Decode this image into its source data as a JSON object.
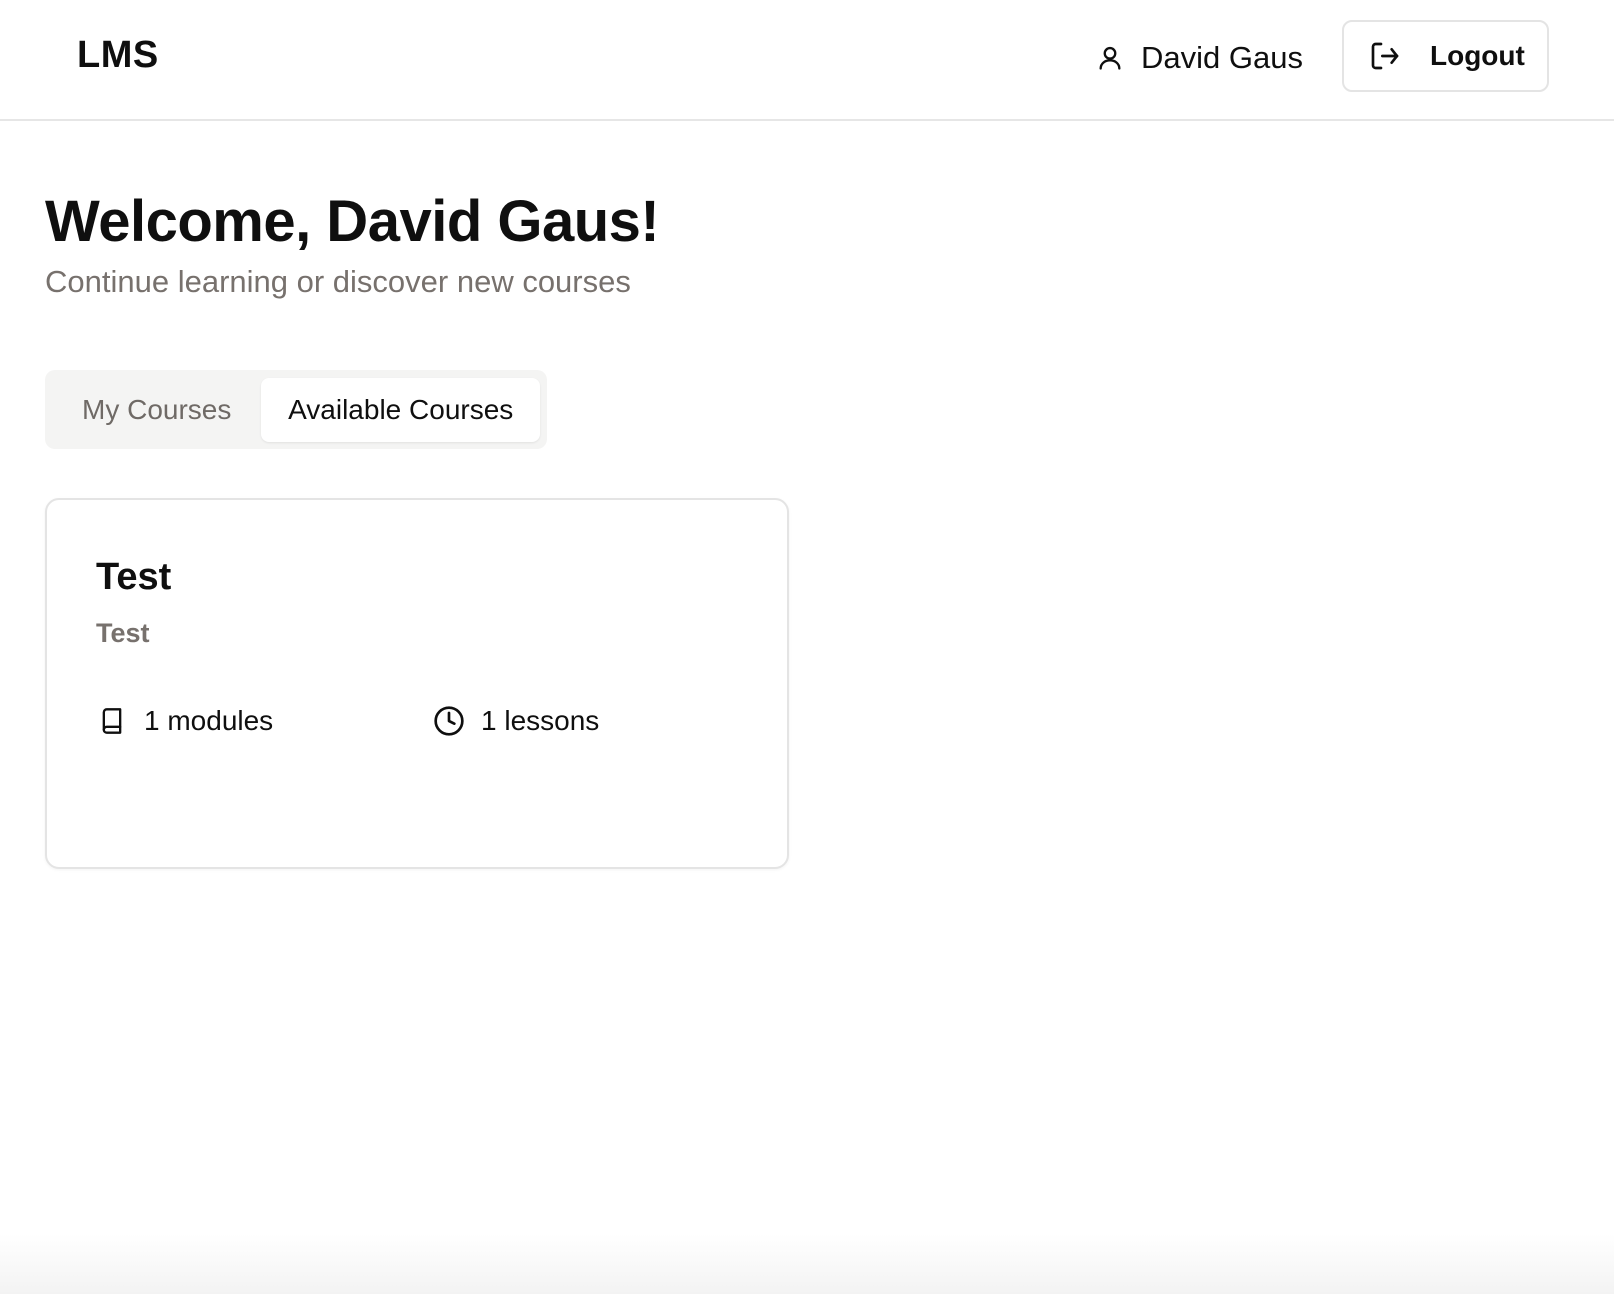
{
  "header": {
    "brand": "LMS",
    "user_name": "David Gaus",
    "user_icon": "user-icon",
    "logout_label": "Logout",
    "logout_icon": "log-out-icon"
  },
  "welcome": {
    "title": "Welcome, David Gaus!",
    "subtitle": "Continue learning or discover new courses"
  },
  "tabs": [
    {
      "label": "My Courses",
      "active": false
    },
    {
      "label": "Available Courses",
      "active": true
    }
  ],
  "courses": [
    {
      "title": "Test",
      "description": "Test",
      "modules_text": "1 modules",
      "modules_icon": "book-icon",
      "lessons_text": "1 lessons",
      "lessons_icon": "clock-icon"
    }
  ],
  "colors": {
    "text_primary": "#0f0f0f",
    "text_muted": "#77716d",
    "tab_bg": "#f4f4f3",
    "border": "#e4e4e4"
  }
}
